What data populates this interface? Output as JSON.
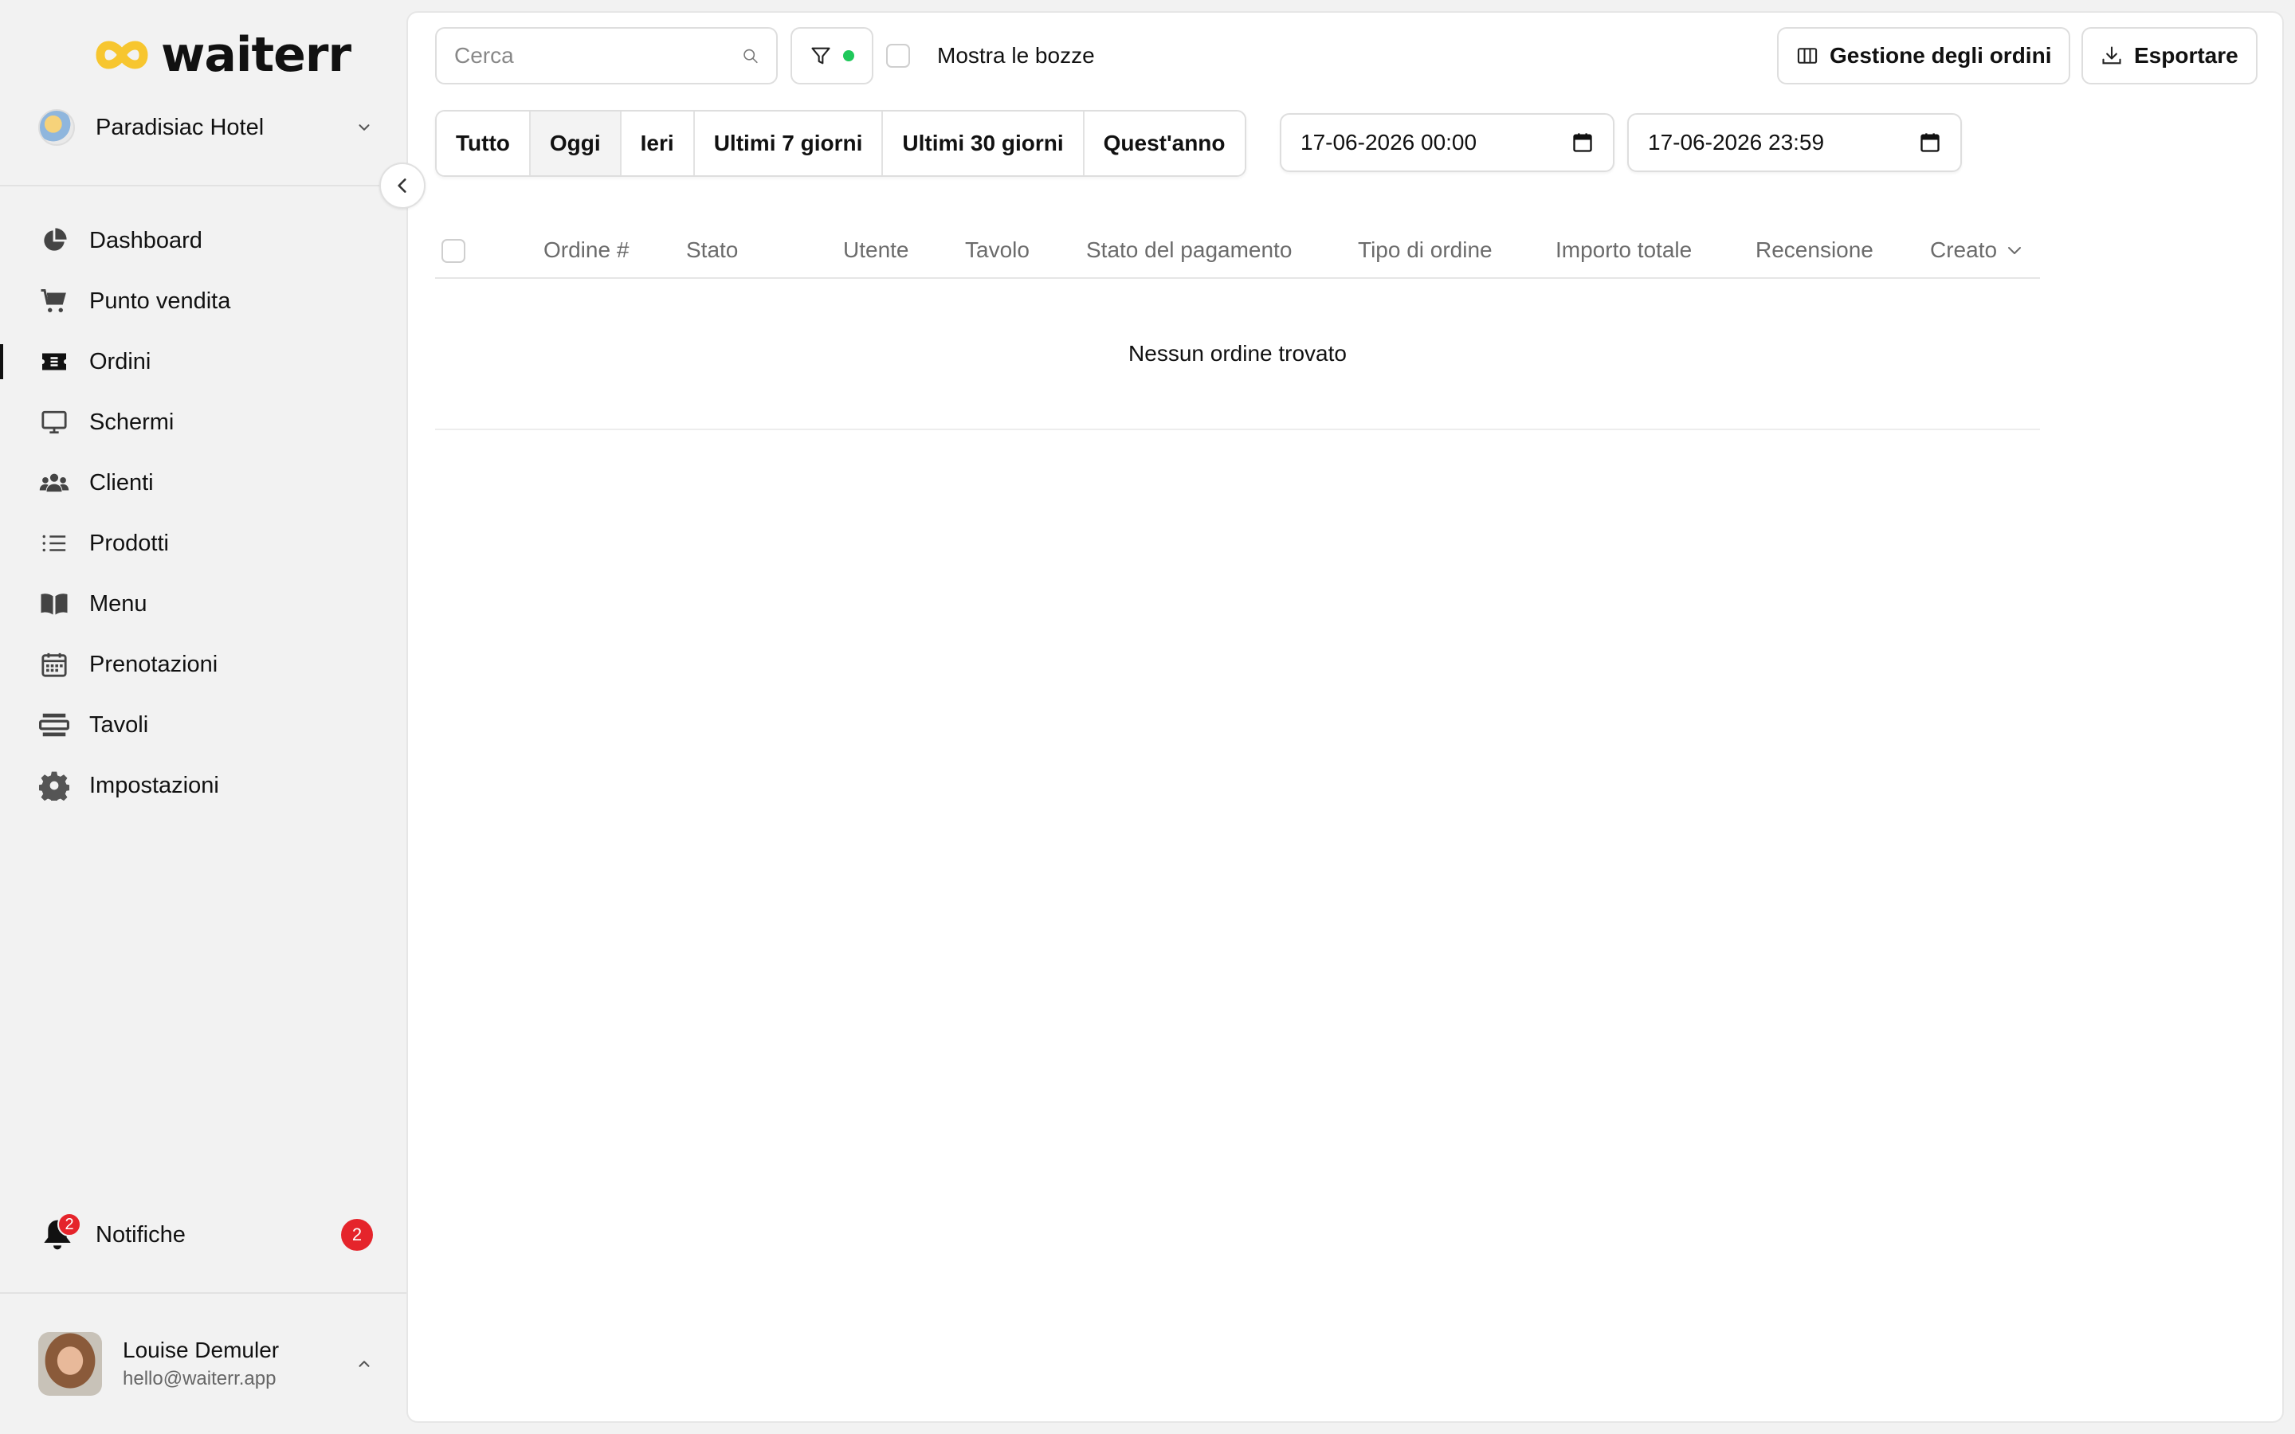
{
  "app": {
    "logo_text": "waiterr"
  },
  "venue": {
    "name": "Paradisiac Hotel"
  },
  "sidebar": {
    "items": [
      {
        "label": "Dashboard",
        "icon": "pie-chart-icon"
      },
      {
        "label": "Punto vendita",
        "icon": "cart-icon"
      },
      {
        "label": "Ordini",
        "icon": "ticket-icon",
        "active": true
      },
      {
        "label": "Schermi",
        "icon": "monitor-icon"
      },
      {
        "label": "Clienti",
        "icon": "users-icon"
      },
      {
        "label": "Prodotti",
        "icon": "list-icon"
      },
      {
        "label": "Menu",
        "icon": "book-icon"
      },
      {
        "label": "Prenotazioni",
        "icon": "calendar-icon"
      },
      {
        "label": "Tavoli",
        "icon": "table-icon"
      },
      {
        "label": "Impostazioni",
        "icon": "gear-icon"
      }
    ],
    "notifications": {
      "label": "Notifiche",
      "count": "2"
    }
  },
  "user": {
    "name": "Louise Demuler",
    "email": "hello@waiterr.app"
  },
  "toolbar": {
    "search_placeholder": "Cerca",
    "show_drafts_label": "Mostra le bozze",
    "manage_orders_label": "Gestione degli ordini",
    "export_label": "Esportare"
  },
  "date_filters": {
    "options": [
      "Tutto",
      "Oggi",
      "Ieri",
      "Ultimi 7 giorni",
      "Ultimi 30 giorni",
      "Quest'anno"
    ],
    "selected": "Oggi",
    "from": "17-06-2026 00:00",
    "to": "17-06-2026 23:59"
  },
  "table": {
    "columns": [
      "Ordine #",
      "Stato",
      "Utente",
      "Tavolo",
      "Stato del pagamento",
      "Tipo di ordine",
      "Importo totale",
      "Recensione",
      "Creato"
    ],
    "empty_message": "Nessun ordine trovato"
  },
  "colors": {
    "accent_yellow": "#f7c62f",
    "active_filter_dot": "#1fc85a",
    "badge_red": "#e5242b"
  }
}
